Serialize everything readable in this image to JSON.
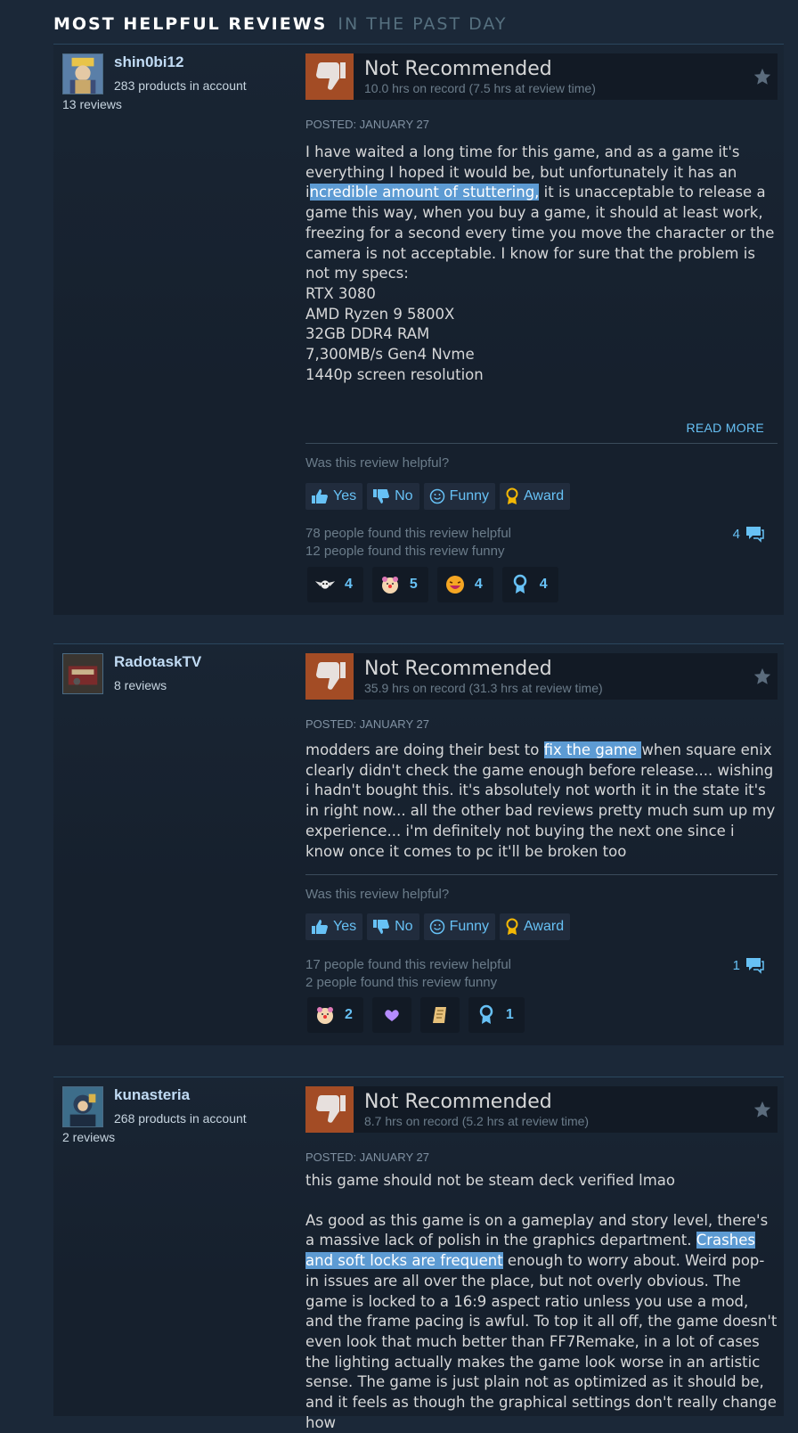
{
  "section": {
    "title": "MOST HELPFUL REVIEWS",
    "subtitle": "IN THE PAST DAY"
  },
  "common": {
    "helpful_question": "Was this review helpful?",
    "btn_yes": "Yes",
    "btn_no": "No",
    "btn_funny": "Funny",
    "btn_award": "Award",
    "read_more": "READ MORE"
  },
  "reviews": [
    {
      "username": "shin0bi12",
      "products": "283 products in account",
      "reviews_count": "13 reviews",
      "verdict": "Not Recommended",
      "hours": "10.0 hrs on record (7.5 hrs at review time)",
      "posted": "POSTED: JANUARY 27",
      "text_before": "I have waited a long time for this game, and as a game it's everything I hoped it would be, but unfortunately it has an i",
      "text_highlight": "ncredible amount of stuttering,",
      "text_after": " it is unacceptable to release a game this way, when you buy a game, it should at least work, freezing for a second every time you move the character or the camera is not acceptable. I know for sure that the problem is not my specs:\nRTX 3080\nAMD Ryzen 9 5800X\n32GB DDR4 RAM\n7,300MB/s Gen4 Nvme\n1440p screen resolution",
      "helpful": "78 people found this review helpful",
      "funny": "12 people found this review funny",
      "comments": "4",
      "awards": [
        {
          "icon": "winged-skull-award-icon",
          "count": "4"
        },
        {
          "icon": "clown-face-award-icon",
          "count": "5"
        },
        {
          "icon": "laughing-face-award-icon",
          "count": "4"
        },
        {
          "icon": "ribbon-award-icon",
          "count": "4"
        }
      ]
    },
    {
      "username": "RadotaskTV",
      "reviews_count": "8 reviews",
      "verdict": "Not Recommended",
      "hours": "35.9 hrs on record (31.3 hrs at review time)",
      "posted": "POSTED: JANUARY 27",
      "text_before": "modders are doing their best to ",
      "text_highlight": "fix the game ",
      "text_after": "when square enix clearly didn't check the game enough before release.... wishing i hadn't bought this. it's absolutely not worth it in the state it's in right now... all the other bad reviews pretty much sum up my experience... i'm definitely not buying the next one since i know once it comes to pc it'll be broken too",
      "helpful": "17 people found this review helpful",
      "funny": "2 people found this review funny",
      "comments": "1",
      "awards": [
        {
          "icon": "clown-face-award-icon",
          "count": "2"
        },
        {
          "icon": "heart-hands-award-icon",
          "count": ""
        },
        {
          "icon": "scroll-award-icon",
          "count": ""
        },
        {
          "icon": "ribbon-award-icon",
          "count": "1"
        }
      ]
    },
    {
      "username": "kunasteria",
      "products": "268 products in account",
      "reviews_count": "2 reviews",
      "verdict": "Not Recommended",
      "hours": "8.7 hrs on record (5.2 hrs at review time)",
      "posted": "POSTED: JANUARY 27",
      "text_intro": "this game should not be steam deck verified lmao",
      "text_before": "As good as this game is on a gameplay and story level, there's a massive lack of polish in the graphics department. ",
      "text_highlight": "Crashes and soft locks are frequent",
      "text_after": " enough to worry about. Weird pop-in issues are all over the place, but not overly obvious. The game is locked to a 16:9 aspect ratio unless you use a mod, and the frame pacing is awful. To top it all off, the game doesn't even look that much better than FF7Remake, in a lot of cases the lighting actually makes the game look worse in an artistic sense. The game is just plain not as optimized as it should be, and it feels as though the graphical settings don't really change how"
    }
  ],
  "colors": {
    "accent": "#67c1f5",
    "thumb_down": "#a34c25",
    "highlight": "#5d9bd3",
    "background": "#1b2838"
  }
}
